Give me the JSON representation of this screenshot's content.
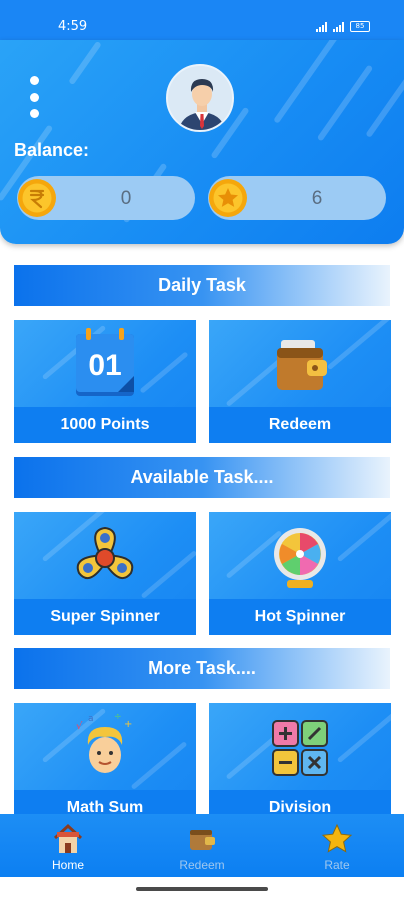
{
  "status_bar": {
    "time": "4:59",
    "battery": "85"
  },
  "header": {
    "balance_label": "Balance:",
    "balances": [
      {
        "icon": "rupee-coin-icon",
        "value": "0"
      },
      {
        "icon": "star-coin-icon",
        "value": "6"
      }
    ]
  },
  "sections": {
    "daily": "Daily Task",
    "available": "Available Task....",
    "more": "More Task...."
  },
  "cards": {
    "points": {
      "label": "1000 Points",
      "icon": "calendar-icon",
      "calendar_day": "01"
    },
    "redeem": {
      "label": "Redeem",
      "icon": "wallet-icon"
    },
    "super_spinner": {
      "label": "Super Spinner",
      "icon": "fidget-spinner-icon"
    },
    "hot_spinner": {
      "label": "Hot Spinner",
      "icon": "prize-wheel-icon"
    },
    "math_sum": {
      "label": "Math Sum",
      "icon": "thinking-kid-icon"
    },
    "division": {
      "label": "Division",
      "icon": "calculator-icon"
    }
  },
  "bottom_nav": [
    {
      "label": "Home",
      "icon": "house-icon"
    },
    {
      "label": "Redeem",
      "icon": "wallet-icon"
    },
    {
      "label": "Rate",
      "icon": "star-icon"
    }
  ],
  "colors": {
    "primary": "#1a86f5",
    "dark_blue": "#0e7ef1",
    "gold": "#f5b50f"
  }
}
